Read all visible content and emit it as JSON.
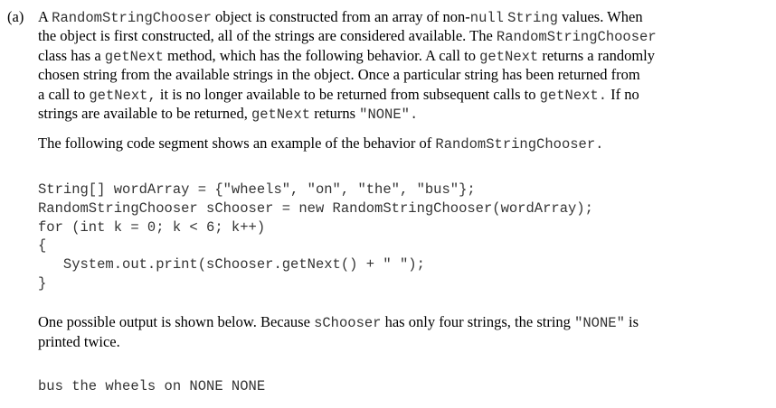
{
  "part_label": "(a)",
  "para1": {
    "l1": [
      {
        "t": "A "
      },
      {
        "c": "RandomStringChooser"
      },
      {
        "t": " object is constructed from an array of non-"
      },
      {
        "c": "null"
      },
      {
        "t": " "
      },
      {
        "c": "String"
      },
      {
        "t": " values. When"
      }
    ],
    "l2": [
      {
        "t": "the object is first constructed, all of the strings are considered available. The "
      },
      {
        "c": "RandomStringChooser"
      }
    ],
    "l3": [
      {
        "t": "class has a "
      },
      {
        "c": "getNext"
      },
      {
        "t": " method, which has the following behavior. A call to "
      },
      {
        "c": "getNext"
      },
      {
        "t": " returns a randomly"
      }
    ],
    "l4": [
      {
        "t": "chosen string from the available strings in the object. Once a particular string has been returned from"
      }
    ],
    "l5": [
      {
        "t": "a call to "
      },
      {
        "c": "getNext,"
      },
      {
        "t": " it is no longer available to be returned from subsequent calls to "
      },
      {
        "c": "getNext."
      },
      {
        "t": " If no"
      }
    ],
    "l6": [
      {
        "t": "strings are available to be returned, "
      },
      {
        "c": "getNext"
      },
      {
        "t": " returns "
      },
      {
        "c": "\"NONE\"."
      }
    ]
  },
  "para2": [
    {
      "t": "The following code segment shows an example of the behavior of "
    },
    {
      "c": "RandomStringChooser."
    }
  ],
  "code": [
    "String[] wordArray = {\"wheels\", \"on\", \"the\", \"bus\"};",
    "RandomStringChooser sChooser = new RandomStringChooser(wordArray);",
    "for (int k = 0; k < 6; k++)",
    "{",
    "   System.out.print(sChooser.getNext() + \" \");",
    "}"
  ],
  "para3": {
    "l1": [
      {
        "t": "One possible output is shown below. Because "
      },
      {
        "c": "sChooser"
      },
      {
        "t": " has only four strings, the string "
      },
      {
        "c": "\"NONE\""
      },
      {
        "t": " is"
      }
    ],
    "l2": [
      {
        "t": "printed twice."
      }
    ]
  },
  "output": "bus the wheels on NONE NONE"
}
